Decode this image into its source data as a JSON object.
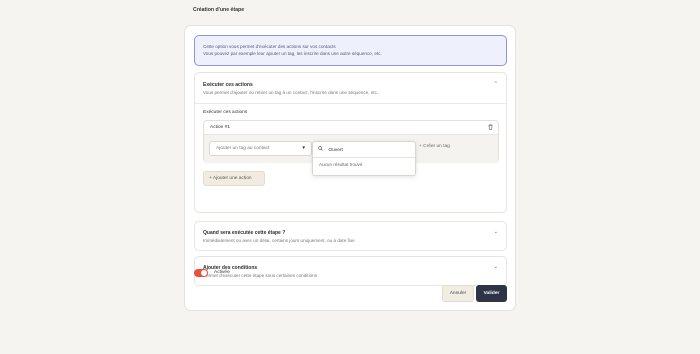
{
  "page": {
    "title": "Création d'une étape"
  },
  "info": {
    "line1": "Cette option vous permet d'exécuter des actions sur vos contacts",
    "line2": "Vous pouvez par exemple leur ajouter un tag, les inscrire dans une autre séquence, etc."
  },
  "section_actions": {
    "title": "Exécuter ces actions",
    "description": "Vous permet d'ajouter ou retirer un tag à un contact, l'inscrire dans une séquence, etc.",
    "field_label": "Exécuter ces actions",
    "action": {
      "title": "Action #1",
      "select_value": "Ajouter un tag au contact",
      "create_tag_label": "Créer un tag"
    },
    "add_action_label": "Ajouter une action",
    "expanded": true
  },
  "dropdown": {
    "search_value": "Ouvert",
    "empty_text": "Aucun résultat trouvé"
  },
  "section_when": {
    "title": "Quand sera exécutée cette étape ?",
    "description": "Immédiatement ou avec un délai, certains jours uniquement, ou à date fixe"
  },
  "section_conditions": {
    "title": "Ajouter des conditions",
    "description": "Permet d'exécuter cette étape sous certaines conditions"
  },
  "toggle": {
    "label": "Activée",
    "on": true
  },
  "buttons": {
    "cancel": "Annuler",
    "submit": "Valider"
  },
  "colors": {
    "accent": "#e5533d",
    "primary": "#2f3347",
    "info_border": "#8c96d9"
  },
  "icons": {
    "chevron_up": "chevron-up-icon",
    "chevron_down": "chevron-down-icon",
    "trash": "trash-icon",
    "search": "search-icon",
    "plus": "plus-icon",
    "caret_down": "caret-down-icon"
  }
}
